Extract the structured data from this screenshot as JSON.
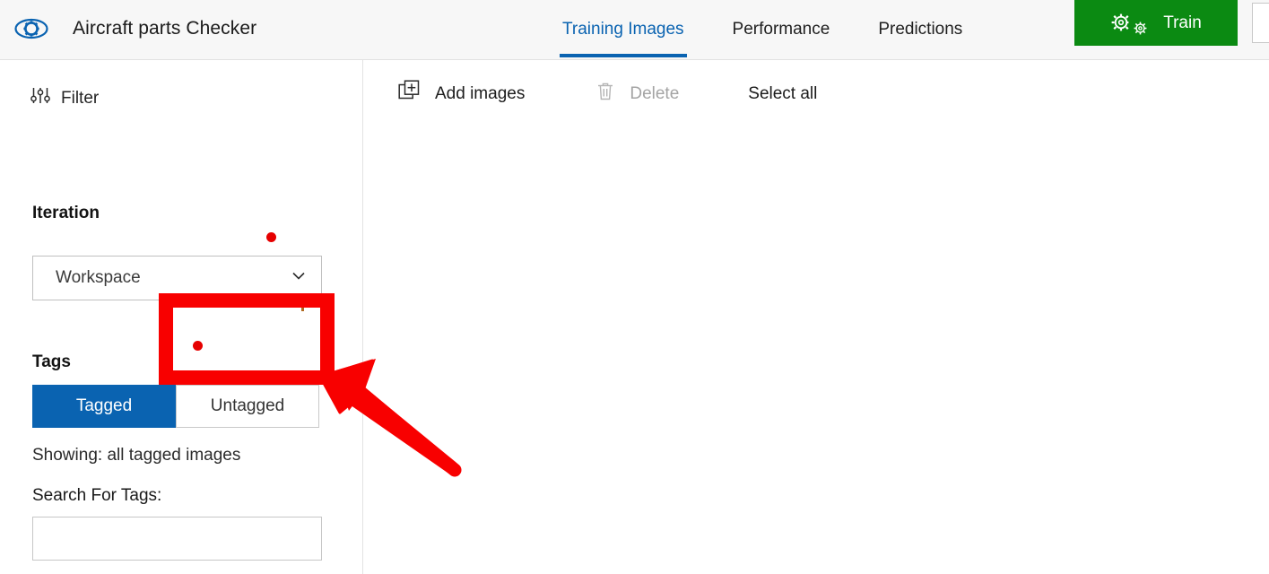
{
  "header": {
    "logo_icon": "eye-gear-icon",
    "title": "Aircraft parts Checker",
    "tabs": [
      {
        "label": "Training Images",
        "active": true
      },
      {
        "label": "Performance",
        "active": false
      },
      {
        "label": "Predictions",
        "active": false
      }
    ],
    "train_button": {
      "label": "Train",
      "icon": "gears-icon",
      "color": "#0b8a12"
    }
  },
  "sidebar": {
    "filter": {
      "label": "Filter",
      "icon": "sliders-icon"
    },
    "iteration": {
      "title": "Iteration",
      "select_value": "Workspace",
      "chevron_icon": "chevron-down-icon"
    },
    "tags": {
      "title": "Tags",
      "tagged_label": "Tagged",
      "untagged_label": "Untagged",
      "active": "Tagged",
      "showing_text": "Showing: all tagged images",
      "search_label": "Search For Tags:",
      "search_value": "",
      "search_placeholder": ""
    }
  },
  "main": {
    "toolbar": {
      "add_images": {
        "label": "Add images",
        "icon": "add-images-icon",
        "enabled": true
      },
      "delete": {
        "label": "Delete",
        "icon": "trash-icon",
        "enabled": false
      },
      "select_all": {
        "label": "Select all",
        "enabled": true
      }
    }
  },
  "annotations": {
    "highlight_color": "#f80000",
    "highlight_target": "Untagged",
    "arrow_direction": "up-left",
    "cursor_color": "#e60000"
  }
}
